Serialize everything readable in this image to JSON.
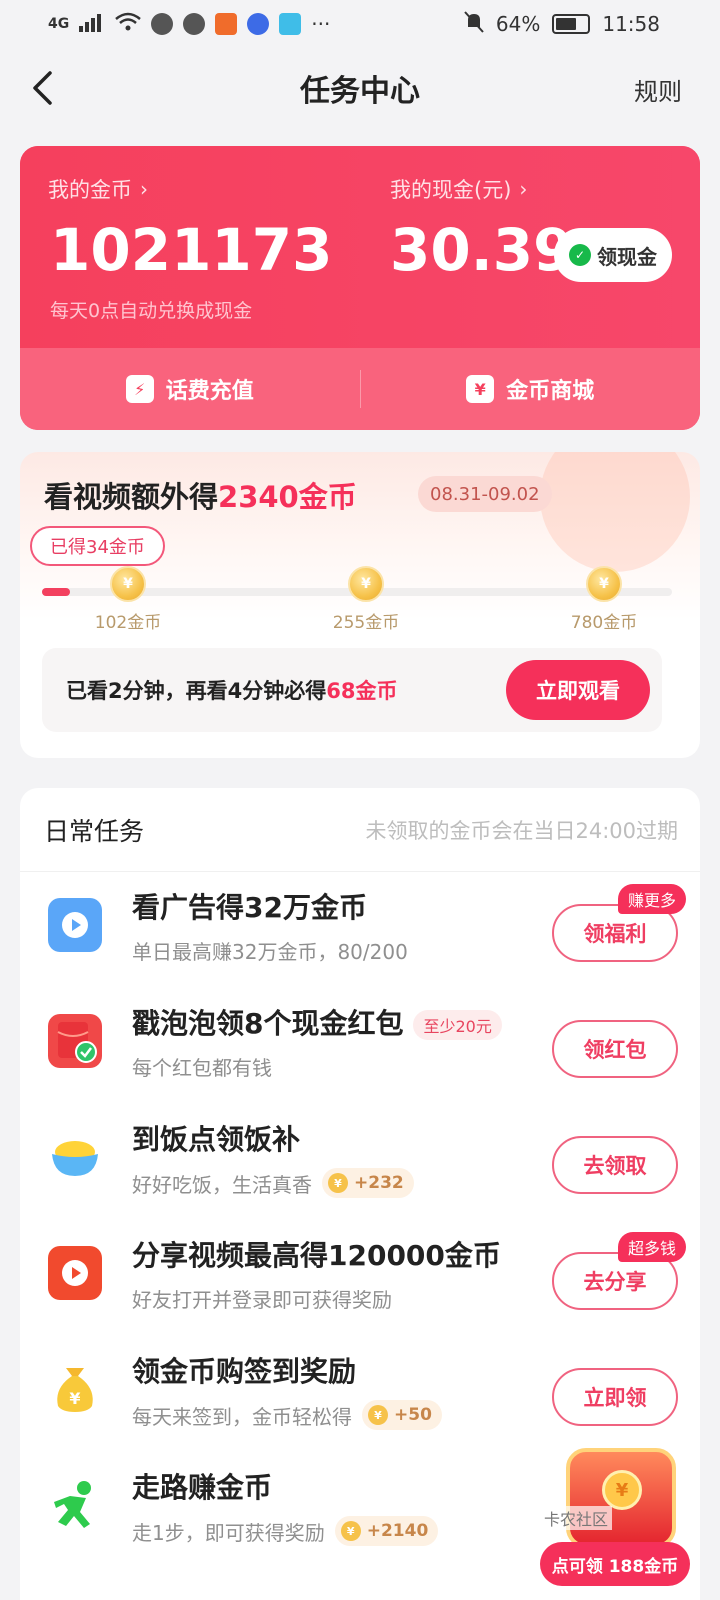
{
  "status_bar": {
    "network": "4G",
    "battery": "64%",
    "time": "11:58",
    "more": "···"
  },
  "header": {
    "title": "任务中心",
    "rules": "规则"
  },
  "coin_card": {
    "coins_label": "我的金币",
    "coins_value": "1021173",
    "cash_label": "我的现金(元)",
    "cash_value": "30.39",
    "cash_button": "领现金",
    "auto_exchange_note": "每天0点自动兑换成现金",
    "recharge": "话费充值",
    "mall": "金币商城"
  },
  "video_bonus": {
    "title_prefix": "看视频额外得",
    "title_amount": "2340金币",
    "date_range": "08.31-09.02",
    "earned": "已得34金币",
    "progress_fraction": 0.045,
    "milestones": [
      {
        "label": "102金币"
      },
      {
        "label": "255金币"
      },
      {
        "label": "780金币"
      }
    ],
    "watch_text_prefix": "已看2分钟，再看4分钟必得",
    "watch_text_amount": "68金币",
    "watch_button": "立即观看"
  },
  "daily": {
    "title": "日常任务",
    "note": "未领取的金币会在当日24:00过期",
    "tasks": [
      {
        "icon": "play-icon",
        "name": "看广告得32万金币",
        "desc": "单日最高赚32万金币，80/200",
        "button": "领福利",
        "badge": "赚更多"
      },
      {
        "icon": "red-envelope-icon",
        "name": "戳泡泡领8个现金红包",
        "tag": "至少20元",
        "desc": "每个红包都有钱",
        "button": "领红包"
      },
      {
        "icon": "rice-bowl-icon",
        "name": "到饭点领饭补",
        "desc": "好好吃饭，生活真香",
        "coins": "+232",
        "button": "去领取"
      },
      {
        "icon": "video-share-icon",
        "name": "分享视频最高得120000金币",
        "desc": "好友打开并登录即可获得奖励",
        "button": "去分享",
        "badge": "超多钱"
      },
      {
        "icon": "money-bag-icon",
        "name": "领金币购签到奖励",
        "desc": "每天来签到，金币轻松得",
        "coins": "+50",
        "button": "立即领"
      },
      {
        "icon": "running-man-icon",
        "name": "走路赚金币",
        "desc": "走1步，即可获得奖励",
        "coins": "+2140"
      }
    ]
  },
  "floating_reward": {
    "watermark": "卡农社区",
    "pill": "点可领 188金币"
  },
  "colors": {
    "brand": "#f5305a",
    "card_red": "#f5405d",
    "coin_gold": "#f6c24a"
  }
}
